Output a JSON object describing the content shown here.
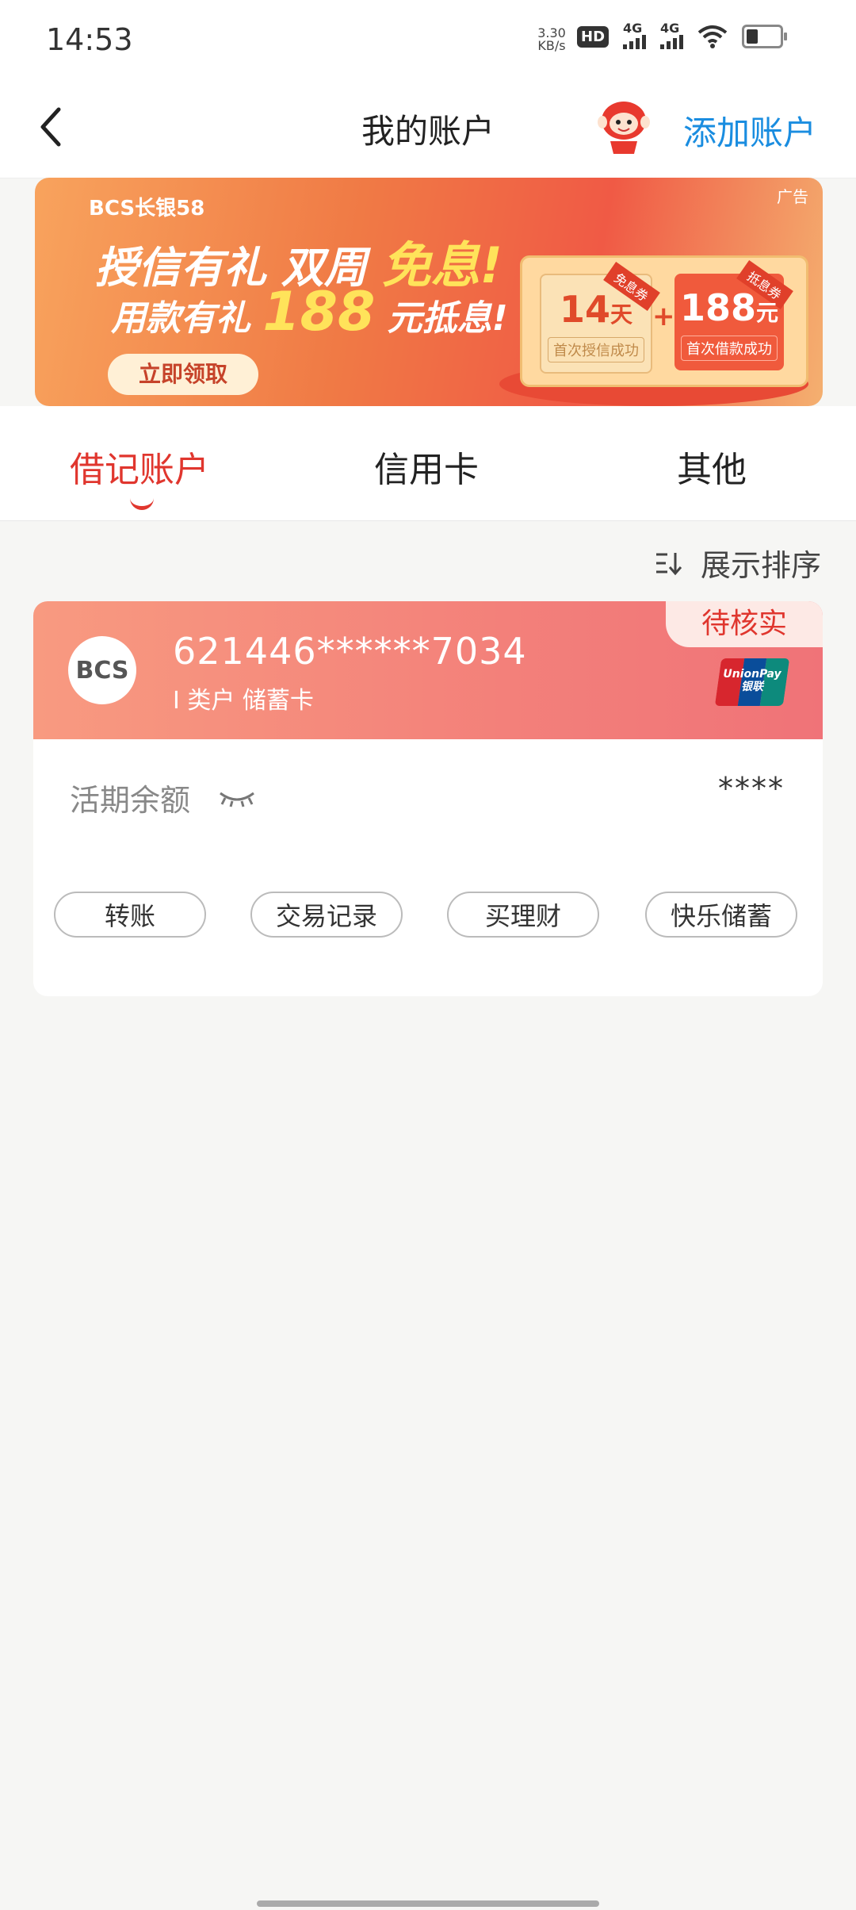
{
  "status_bar": {
    "time": "14:53",
    "net_speed_value": "3.30",
    "net_speed_unit": "KB/s",
    "hd_label": "HD",
    "signal1_label": "4G",
    "signal2_label": "4G",
    "icons": [
      "hd-icon",
      "signal-icon",
      "signal-icon",
      "wifi-icon",
      "battery-icon"
    ]
  },
  "header": {
    "title": "我的账户",
    "add_account_label": "添加账户"
  },
  "banner": {
    "brand": "BCS长银58",
    "ad_tag": "广告",
    "line1_a": "授信有礼 双周 ",
    "line1_highlight": "免息!",
    "line2_a": "用款有礼 ",
    "line2_highlight": "188",
    "line2_b": " 元抵息!",
    "button_label": "立即领取",
    "coupon1_ribbon": "免息券",
    "coupon1_value": "14",
    "coupon1_unit": "天",
    "coupon1_sub": "首次授信成功",
    "plus": "+",
    "coupon2_ribbon": "抵息券",
    "coupon2_value": "188",
    "coupon2_unit": "元",
    "coupon2_sub": "首次借款成功"
  },
  "tabs": [
    {
      "label": "借记账户",
      "active": true
    },
    {
      "label": "信用卡",
      "active": false
    },
    {
      "label": "其他",
      "active": false
    }
  ],
  "sort_label": "展示排序",
  "account_card": {
    "bank_logo": "BCS",
    "status_badge": "待核实",
    "card_number": "621446******7034",
    "card_type": "Ⅰ 类户  储蓄卡",
    "unionpay_label": "UnionPay",
    "unionpay_cn": "银联",
    "balance_label": "活期余额",
    "balance_value": "****",
    "actions": [
      "转账",
      "交易记录",
      "买理财",
      "快乐储蓄"
    ]
  },
  "colors": {
    "accent_red": "#e0362e",
    "link_blue": "#1a8de0"
  }
}
